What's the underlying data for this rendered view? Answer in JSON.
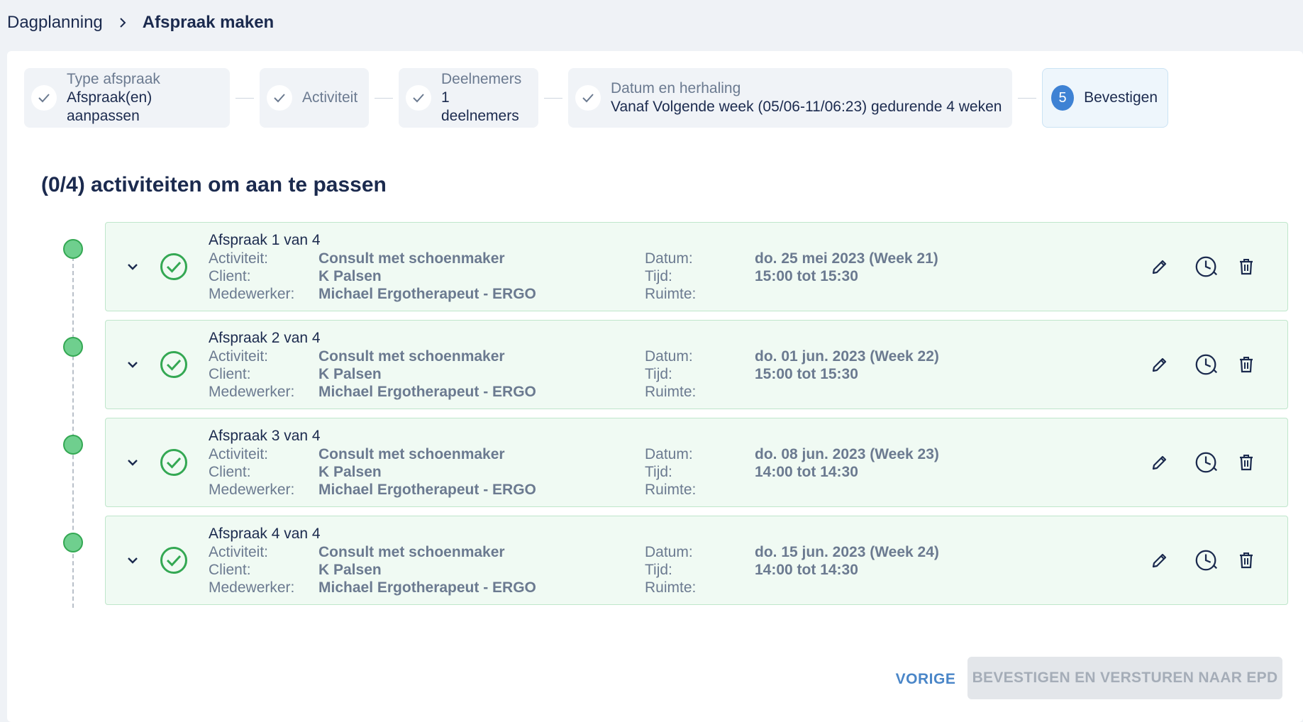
{
  "breadcrumb": {
    "parent": "Dagplanning",
    "current": "Afspraak maken"
  },
  "stepper": {
    "steps": [
      {
        "label": "Type afspraak",
        "value": "Afspraak(en) aanpassen",
        "status": "done"
      },
      {
        "label": "Activiteit",
        "status": "done"
      },
      {
        "label": "Deelnemers",
        "value": "1 deelnemers",
        "status": "done"
      },
      {
        "label": "Datum en herhaling",
        "value": "Vanaf Volgende week (05/06-11/06:23) gedurende 4 weken",
        "status": "done"
      },
      {
        "number": "5",
        "label": "Bevestigen",
        "status": "active"
      }
    ]
  },
  "section": {
    "title": "(0/4) activiteiten om aan te passen"
  },
  "labels": {
    "activiteit": "Activiteit:",
    "client": "Client:",
    "medewerker": "Medewerker:",
    "datum": "Datum:",
    "tijd": "Tijd:",
    "ruimte": "Ruimte:"
  },
  "appointments": [
    {
      "title": "Afspraak 1 van 4",
      "activiteit": "Consult met schoenmaker",
      "client": "K Palsen",
      "medewerker": "Michael Ergotherapeut - ERGO",
      "datum": "do. 25 mei 2023 (Week 21)",
      "tijd": "15:00 tot 15:30",
      "ruimte": ""
    },
    {
      "title": "Afspraak 2 van 4",
      "activiteit": "Consult met schoenmaker",
      "client": "K Palsen",
      "medewerker": "Michael Ergotherapeut - ERGO",
      "datum": "do. 01 jun. 2023 (Week 22)",
      "tijd": "15:00 tot 15:30",
      "ruimte": ""
    },
    {
      "title": "Afspraak 3 van 4",
      "activiteit": "Consult met schoenmaker",
      "client": "K Palsen",
      "medewerker": "Michael Ergotherapeut - ERGO",
      "datum": "do. 08 jun. 2023 (Week 23)",
      "tijd": "14:00 tot 14:30",
      "ruimte": ""
    },
    {
      "title": "Afspraak 4 van 4",
      "activiteit": "Consult met schoenmaker",
      "client": "K Palsen",
      "medewerker": "Michael Ergotherapeut - ERGO",
      "datum": "do. 15 jun. 2023 (Week 24)",
      "tijd": "14:00 tot 14:30",
      "ruimte": ""
    }
  ],
  "footer": {
    "prev_label": "VORIGE",
    "confirm_label": "BEVESTIGEN EN VERSTUREN NAAR EPD"
  },
  "icons": {
    "step_check": "check-icon",
    "expand": "chevron-down-icon",
    "status": "check-circle-icon",
    "edit": "pencil-icon",
    "time": "clock-icon",
    "delete": "trash-icon"
  },
  "colors": {
    "accent": "#3e82d4",
    "success": "#34a853",
    "row_background": "#f0faf3",
    "text_primary": "#1b2a4e",
    "text_muted": "#6b7a90"
  }
}
